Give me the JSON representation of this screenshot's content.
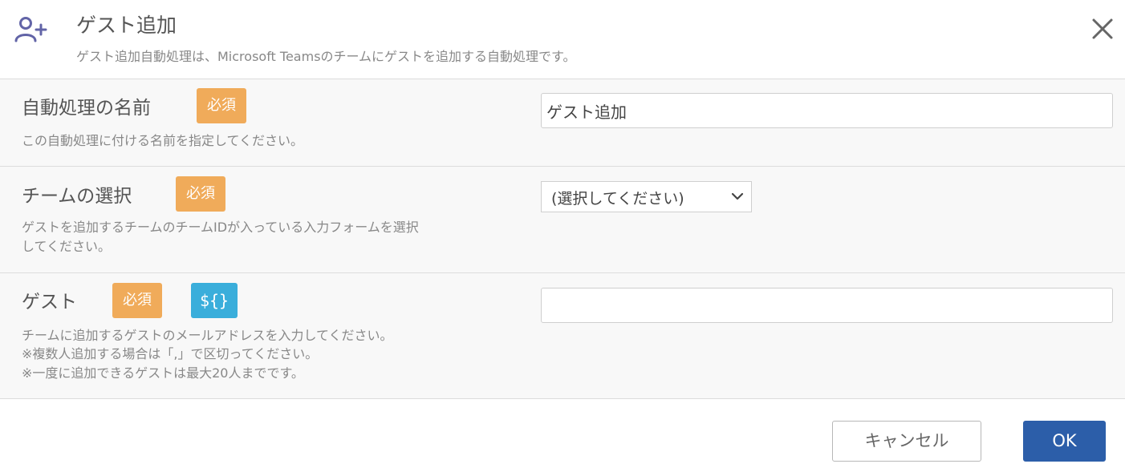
{
  "header": {
    "title": "ゲスト追加",
    "description": "ゲスト追加自動処理は、Microsoft Teamsのチームにゲストを追加する自動処理です。",
    "icon": "user-plus-icon",
    "close_icon": "close-icon"
  },
  "fields": {
    "name": {
      "label": "自動処理の名前",
      "badge": "必須",
      "description": "この自動処理に付ける名前を指定してください。",
      "value": "ゲスト追加"
    },
    "team": {
      "label": "チームの選択",
      "badge": "必須",
      "description_line1": "ゲストを追加するチームのチームIDが入っている入力フォームを選択",
      "description_line2": "してください。",
      "selected": "(選択してください)"
    },
    "guest": {
      "label": "ゲスト",
      "badge": "必須",
      "variable_badge": "${}",
      "description_line1": "チームに追加するゲストのメールアドレスを入力してください。",
      "description_line2": "※複数人追加する場合は「,」で区切ってください。",
      "description_line3": "※一度に追加できるゲストは最大20人までです。",
      "value": ""
    }
  },
  "footer": {
    "cancel_label": "キャンセル",
    "ok_label": "OK"
  },
  "colors": {
    "accent_icon": "#6264a7",
    "required_badge": "#f0ab5a",
    "variable_badge": "#3aaedb",
    "ok_button": "#2c5ea9"
  }
}
